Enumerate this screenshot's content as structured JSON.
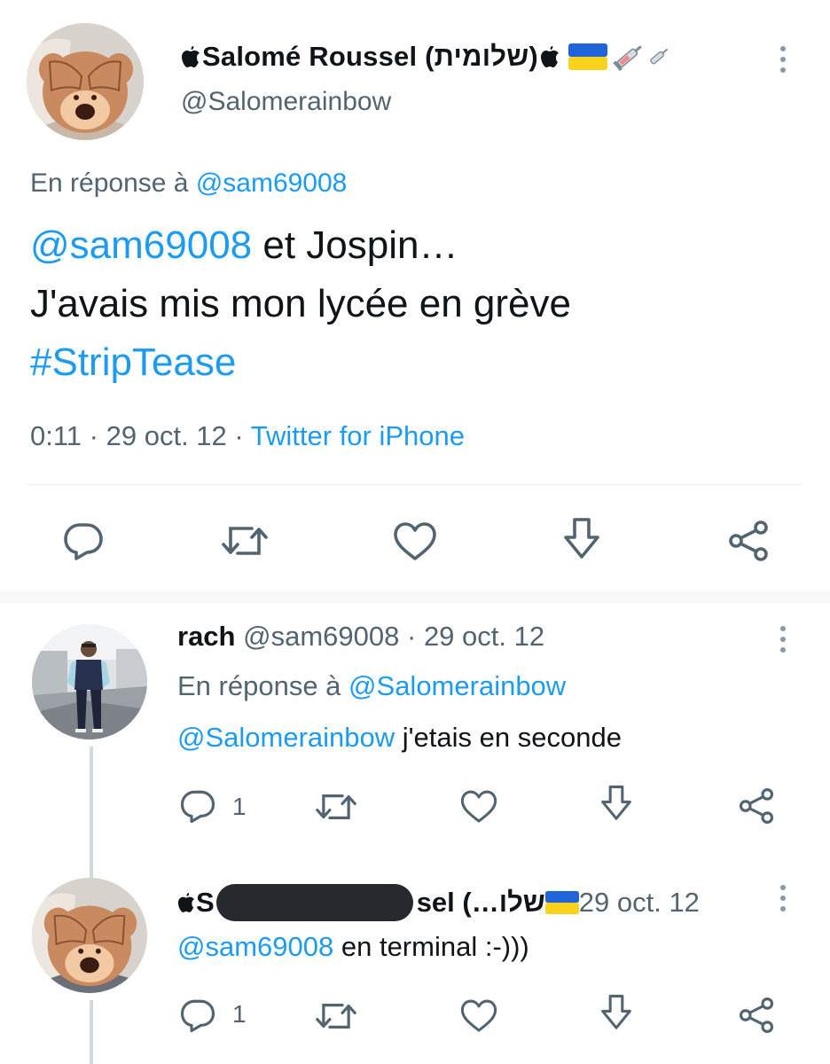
{
  "main_tweet": {
    "display_name": "Salomé Roussel (שלומית)",
    "handle": "@Salomerainbow",
    "reply_prefix": "En réponse à",
    "reply_to": "@sam69008",
    "text_mention": "@sam69008",
    "text_line1": " et Jospin…",
    "text_line2": "J'avais mis mon lycée en grève",
    "hashtag": "#StripTease",
    "time": "0:11",
    "date": "29 oct. 12",
    "source": "Twitter for iPhone",
    "dot": "·"
  },
  "reply1": {
    "display_name": "rach",
    "handle": "@sam69008",
    "dot": "·",
    "date": "29 oct. 12",
    "reply_prefix": "En réponse à",
    "reply_to": "@Salomerainbow",
    "mention": "@Salomerainbow",
    "text": " j'etais en seconde",
    "reply_count": "1"
  },
  "reply2": {
    "name_start": "S",
    "name_end": "sel (…שלו",
    "date": "29 oct. 12",
    "mention": "@sam69008",
    "text": " en terminal :-)))",
    "reply_count": "1"
  },
  "colors": {
    "link": "#1d9bf0",
    "secondary": "#536471",
    "icon": "#536471"
  },
  "icons": [
    "apple-logo-icon",
    "ukraine-flag-icon",
    "syringe-icon",
    "more-icon",
    "reply-icon",
    "retweet-icon",
    "like-icon",
    "download-icon",
    "share-icon"
  ]
}
